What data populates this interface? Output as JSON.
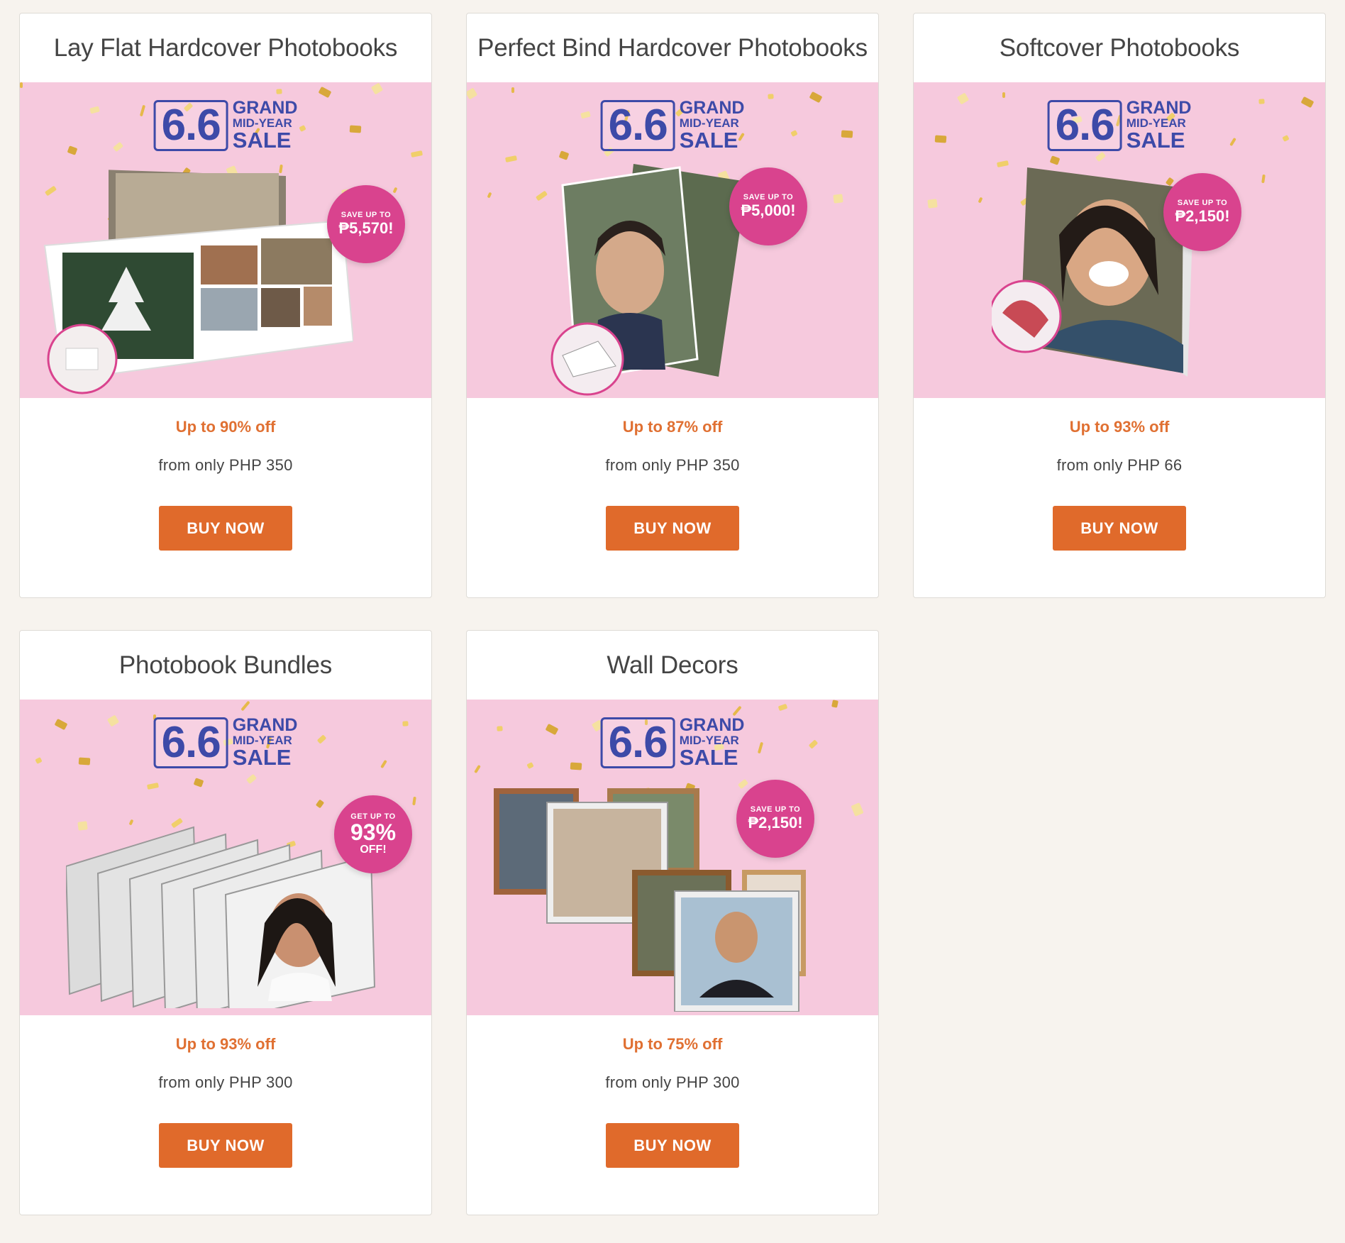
{
  "products": [
    {
      "title": "Lay Flat Hardcover Photobooks",
      "sale_logo": {
        "number": "6.6",
        "line1": "GRAND",
        "line2": "MID-YEAR",
        "line3": "SALE"
      },
      "badge": {
        "top": "SAVE UP TO",
        "value": "₱5,570!"
      },
      "discount": "Up to 90% off",
      "price": "from only PHP 350",
      "button": "BUY NOW"
    },
    {
      "title": "Perfect Bind Hardcover Photobooks",
      "sale_logo": {
        "number": "6.6",
        "line1": "GRAND",
        "line2": "MID-YEAR",
        "line3": "SALE"
      },
      "badge": {
        "top": "SAVE UP TO",
        "value": "₱5,000!"
      },
      "discount": "Up to 87% off",
      "price": "from only PHP 350",
      "button": "BUY NOW"
    },
    {
      "title": "Softcover Photobooks",
      "sale_logo": {
        "number": "6.6",
        "line1": "GRAND",
        "line2": "MID-YEAR",
        "line3": "SALE"
      },
      "badge": {
        "top": "SAVE UP TO",
        "value": "₱2,150!"
      },
      "discount": "Up to 93% off",
      "price": "from only PHP 66",
      "button": "BUY NOW"
    },
    {
      "title": "Photobook Bundles",
      "sale_logo": {
        "number": "6.6",
        "line1": "GRAND",
        "line2": "MID-YEAR",
        "line3": "SALE"
      },
      "badge": {
        "top": "GET UP TO",
        "value": "93%",
        "suffix": "OFF!"
      },
      "discount": "Up to 93% off",
      "price": "from only PHP 300",
      "button": "BUY NOW"
    },
    {
      "title": "Wall Decors",
      "sale_logo": {
        "number": "6.6",
        "line1": "GRAND",
        "line2": "MID-YEAR",
        "line3": "SALE"
      },
      "badge": {
        "top": "SAVE UP TO",
        "value": "₱2,150!"
      },
      "discount": "Up to 75% off",
      "price": "from only PHP 300",
      "button": "BUY NOW"
    }
  ],
  "colors": {
    "page_bg": "#f7f3ee",
    "banner_bg": "#f6c9dd",
    "sale_blue": "#3d4aa8",
    "badge_pink": "#d9438e",
    "accent_orange": "#e06a2b",
    "discount_orange": "#e07032"
  }
}
